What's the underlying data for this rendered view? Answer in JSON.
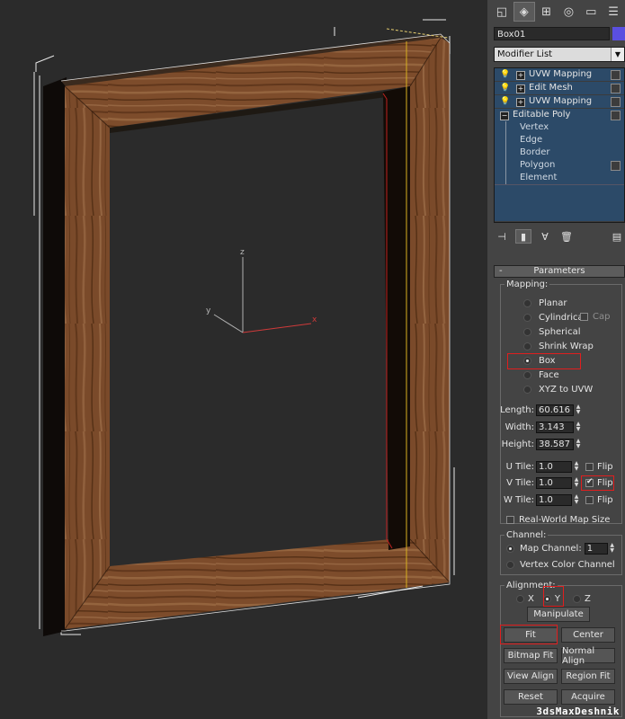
{
  "viewport": {
    "axis_labels": {
      "z": "z",
      "y": "y",
      "x": "x"
    }
  },
  "command_panel": {
    "tabs": [
      "create-icon",
      "modify-icon",
      "hierarchy-icon",
      "motion-icon",
      "display-icon",
      "utilities-icon"
    ],
    "object_name": "Box01",
    "object_color": "#5a4fe0",
    "modifier_list_label": "Modifier List",
    "stack": [
      {
        "label": "UVW Mapping",
        "type": "modifier"
      },
      {
        "label": "Edit Mesh",
        "type": "modifier"
      },
      {
        "label": "UVW Mapping",
        "type": "modifier"
      },
      {
        "label": "Editable Poly",
        "type": "base"
      },
      {
        "label": "Vertex",
        "type": "sub"
      },
      {
        "label": "Edge",
        "type": "sub"
      },
      {
        "label": "Border",
        "type": "sub"
      },
      {
        "label": "Polygon",
        "type": "sub"
      },
      {
        "label": "Element",
        "type": "sub"
      }
    ],
    "stack_tools": [
      "pin-stack-icon",
      "show-end-result-icon",
      "make-unique-icon",
      "remove-modifier-icon",
      "configure-sets-icon"
    ]
  },
  "parameters": {
    "rollout_sign": "-",
    "rollout_title": "Parameters",
    "mapping_label": "Mapping:",
    "mapping_options": [
      "Planar",
      "Cylindrical",
      "Spherical",
      "Shrink Wrap",
      "Box",
      "Face",
      "XYZ to UVW"
    ],
    "mapping_selected": "Box",
    "cap_label": "Cap",
    "length_label": "Length:",
    "length_value": "60.616",
    "width_label": "Width:",
    "width_value": "3.143",
    "height_label": "Height:",
    "height_value": "38.587",
    "u_tile_label": "U Tile:",
    "u_tile_value": "1.0",
    "v_tile_label": "V Tile:",
    "v_tile_value": "1.0",
    "w_tile_label": "W Tile:",
    "w_tile_value": "1.0",
    "flip_label": "Flip",
    "real_world_label": "Real-World Map Size",
    "channel_label": "Channel:",
    "map_channel_label": "Map Channel:",
    "map_channel_value": "1",
    "vertex_color_label": "Vertex Color Channel",
    "alignment_label": "Alignment:",
    "align_x": "X",
    "align_y": "Y",
    "align_z": "Z",
    "manipulate_label": "Manipulate",
    "fit_label": "Fit",
    "center_label": "Center",
    "bitmap_fit_label": "Bitmap Fit",
    "normal_align_label": "Normal Align",
    "view_align_label": "View Align",
    "region_fit_label": "Region Fit",
    "reset_label": "Reset",
    "acquire_label": "Acquire"
  },
  "watermark": "3dsMaxDeshnik"
}
